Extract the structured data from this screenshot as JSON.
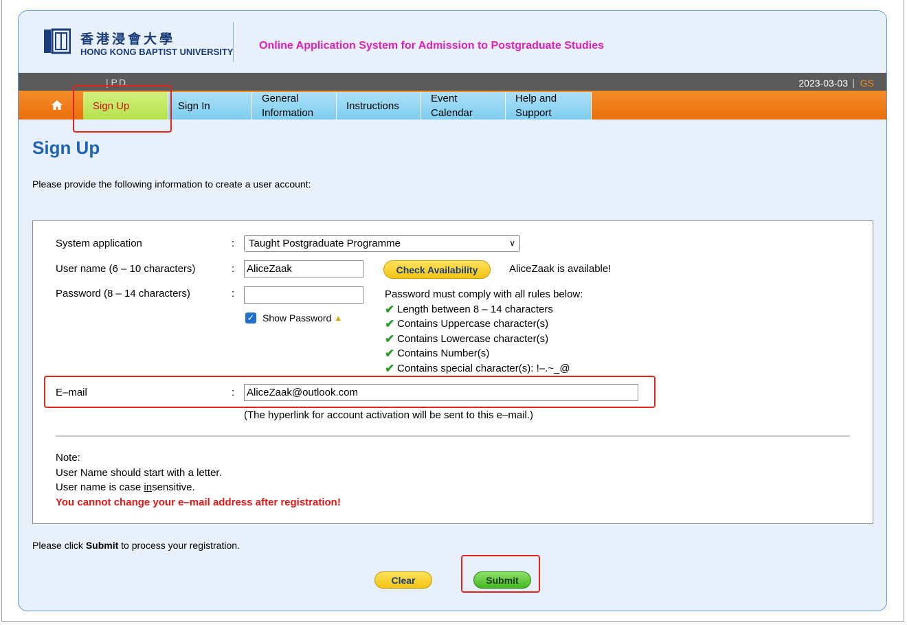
{
  "header": {
    "university_cn": "香港浸會大學",
    "university_en": "HONG KONG BAPTIST UNIVERSITY",
    "system_title": "Online Application System for Admission to Postgraduate Studies"
  },
  "topbar": {
    "left_text": "| P.D.",
    "date": "2023-03-03",
    "separator": "|",
    "user_code": "GS"
  },
  "nav": {
    "home_icon": "home-icon",
    "items": [
      {
        "label": "Sign Up",
        "active": true
      },
      {
        "label": "Sign In"
      },
      {
        "label": "General\nInformation"
      },
      {
        "label": "Instructions"
      },
      {
        "label": "Event\nCalendar"
      },
      {
        "label": "Help and\nSupport"
      }
    ]
  },
  "page": {
    "title": "Sign Up",
    "intro": "Please provide the following information to create a user account:"
  },
  "form": {
    "system_application": {
      "label": "System application",
      "value": "Taught Postgraduate Programme"
    },
    "username": {
      "label": "User name (6 – 10 characters)",
      "value": "AliceZaak",
      "check_button": "Check Availability",
      "status": "AliceZaak is available!"
    },
    "password": {
      "label": "Password (8 – 14 characters)",
      "show_password_label": "Show Password",
      "show_password_checked": true
    },
    "password_rules": {
      "heading": "Password must comply with all rules below:",
      "rules": [
        "Length between 8 – 14 characters",
        "Contains Uppercase character(s)",
        "Contains Lowercase character(s)",
        "Contains Number(s)",
        "Contains special character(s): !–.~_@"
      ]
    },
    "email": {
      "label": "E–mail",
      "value": "AliceZaak@outlook.com",
      "hint": "(The hyperlink for account activation will be sent to this e–mail.)"
    },
    "colon": ":"
  },
  "notes": {
    "heading": "Note:",
    "line1": "User Name should start with a letter.",
    "line2_pre": "User name is case ",
    "line2_u": "in",
    "line2_post": "sensitive.",
    "warning": "You cannot change your e–mail address after registration!"
  },
  "footer": {
    "instruction_pre": "Please click ",
    "instruction_bold": "Submit",
    "instruction_post": " to process your registration.",
    "clear_button": "Clear",
    "submit_button": "Submit"
  },
  "colors": {
    "accent_blue": "#1f64b3",
    "nav_orange": "#f58c2a",
    "highlight_red": "#e0241a",
    "title_magenta": "#e01fbf"
  }
}
